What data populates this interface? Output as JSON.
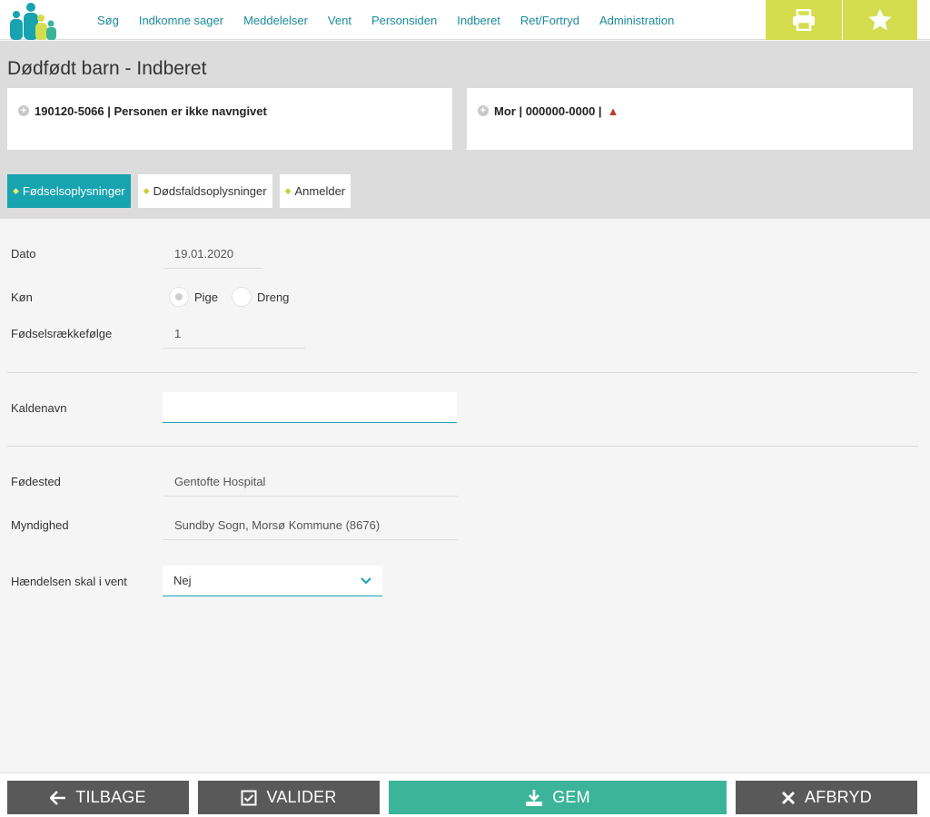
{
  "nav": {
    "items": [
      "Søg",
      "Indkomne sager",
      "Meddelelser",
      "Vent",
      "Personsiden",
      "Indberet",
      "Ret/Fortryd",
      "Administration"
    ],
    "print_icon": "printer-icon",
    "favorite_icon": "star-icon"
  },
  "header": {
    "title": "Dødfødt barn - Indberet",
    "person_card": "190120-5066 | Personen er ikke navngivet",
    "mother_card": "Mor | 000000-0000 |",
    "tabs": [
      "Fødselsoplysninger",
      "Dødsfaldsoplysninger",
      "Anmelder"
    ],
    "active_tab": "Fødselsoplysninger"
  },
  "form": {
    "dato_label": "Dato",
    "dato_value": "19.01.2020",
    "kon_label": "Køn",
    "kon_options": [
      "Pige",
      "Dreng"
    ],
    "kon_selected": "Pige",
    "raekke_label": "Fødselsrækkefølge",
    "raekke_value": "1",
    "kaldenavn_label": "Kaldenavn",
    "kaldenavn_value": "",
    "fodested_label": "Fødested",
    "fodested_value": "Gentofte Hospital",
    "myndighed_label": "Myndighed",
    "myndighed_value": "Sundby Sogn, Morsø Kommune (8676)",
    "vent_label": "Hændelsen skal i vent",
    "vent_value": "Nej"
  },
  "actions": {
    "back": "TILBAGE",
    "validate": "VALIDER",
    "save": "GEM",
    "abort": "AFBRYD"
  },
  "colors": {
    "accent": "#17a3b0",
    "yellow": "#d4dd4e",
    "save": "#3bb49a",
    "dark_button": "#595959"
  }
}
